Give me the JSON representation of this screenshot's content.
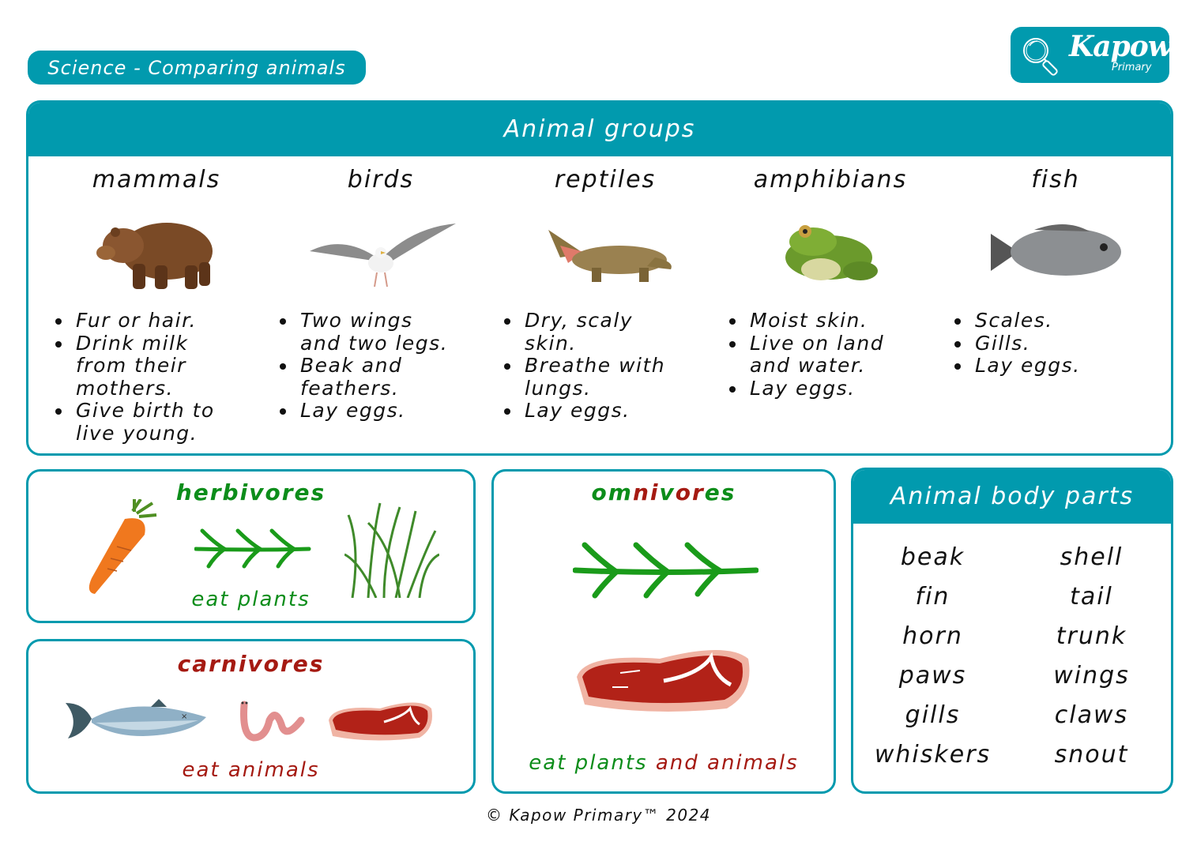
{
  "header": {
    "title": "Science - Comparing animals",
    "logo": {
      "brand": "Kapow",
      "sub": "Primary",
      "icon": "magnifier-icon"
    }
  },
  "colors": {
    "teal": "#019aae",
    "green": "#0c8d1a",
    "red": "#a51a12"
  },
  "animal_groups": {
    "title": "Animal groups",
    "groups": [
      {
        "name": "mammals",
        "image": "bear-image",
        "facts": [
          "Fur or hair.",
          "Drink milk from their mothers.",
          "Give birth to live young."
        ]
      },
      {
        "name": "birds",
        "image": "seagull-image",
        "facts": [
          "Two wings and two legs.",
          "Beak and feathers.",
          "Lay eggs."
        ]
      },
      {
        "name": "reptiles",
        "image": "crocodile-image",
        "facts": [
          "Dry, scaly skin.",
          "Breathe with lungs.",
          "Lay eggs."
        ]
      },
      {
        "name": "amphibians",
        "image": "frog-image",
        "facts": [
          "Moist skin.",
          "Live on land and water.",
          "Lay eggs."
        ]
      },
      {
        "name": "fish",
        "image": "fish-image",
        "facts": [
          "Scales.",
          "Gills.",
          "Lay eggs."
        ]
      }
    ]
  },
  "herbivores": {
    "title": "herbivores",
    "caption": "eat plants",
    "images": [
      "carrot-image",
      "arrow-icon",
      "grass-image"
    ]
  },
  "carnivores": {
    "title": "carnivores",
    "caption": "eat animals",
    "images": [
      "fish-image",
      "worm-image",
      "steak-image"
    ]
  },
  "omnivores": {
    "title_parts": [
      "om",
      "ni",
      "v",
      "or",
      "es"
    ],
    "caption_plants": "eat plants",
    "caption_and": "and animals",
    "images": [
      "arrow-icon",
      "steak-image"
    ]
  },
  "body_parts": {
    "title": "Animal body parts",
    "words": [
      "beak",
      "shell",
      "fin",
      "tail",
      "horn",
      "trunk",
      "paws",
      "wings",
      "gills",
      "claws",
      "whiskers",
      "snout"
    ]
  },
  "footer": "© Kapow Primary™ 2024"
}
